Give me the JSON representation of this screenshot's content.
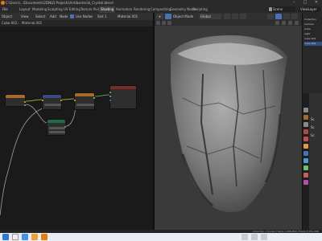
{
  "window": {
    "path": "C:\\Users\\...\\Documents\\2DNLD Projects\\Antibacterial_Crystal.blend"
  },
  "menubar": {
    "menus": "File",
    "tabs": [
      "Layout",
      "Modeling",
      "Sculpting",
      "UV Editing",
      "Texture Paint",
      "Shading",
      "Animation",
      "Rendering",
      "Compositing",
      "Geometry Nodes",
      "Scripting"
    ],
    "active_tab": "Shading",
    "scene": "Scene",
    "view_layer": "ViewLayer"
  },
  "node_editor": {
    "header": {
      "object_menu": "Object",
      "view_menu": "View",
      "select_menu": "Select",
      "add_menu": "Add",
      "node_menu": "Node",
      "use_nodes": "Use Nodes",
      "slot": "Slot 1",
      "material": "Material.001"
    },
    "breadcrumb": {
      "object": "Cube.002",
      "material": "Material.001"
    }
  },
  "viewport": {
    "mode": "Object Mode",
    "view_menu": "View",
    "select_menu": "Select",
    "add_menu": "Add",
    "object_menu": "Object",
    "orientation": "Global"
  },
  "outliner": {
    "items": [
      "Collection",
      "Camera",
      "Cube",
      "Light",
      "Cube.001",
      "Cube.002"
    ]
  },
  "properties": {
    "labels": [
      "Sc",
      "Sc",
      "Sc"
    ]
  },
  "statusbar": {
    "text": "Collection | Crystal | Verts 1,996,899 | Faces 3,761,488"
  },
  "colors": {
    "node_orange": "#a86a2b",
    "node_green": "#1e6b4a",
    "node_blue": "#3b4a82",
    "node_red": "#7a2c2c",
    "accent": "#4772b3"
  }
}
